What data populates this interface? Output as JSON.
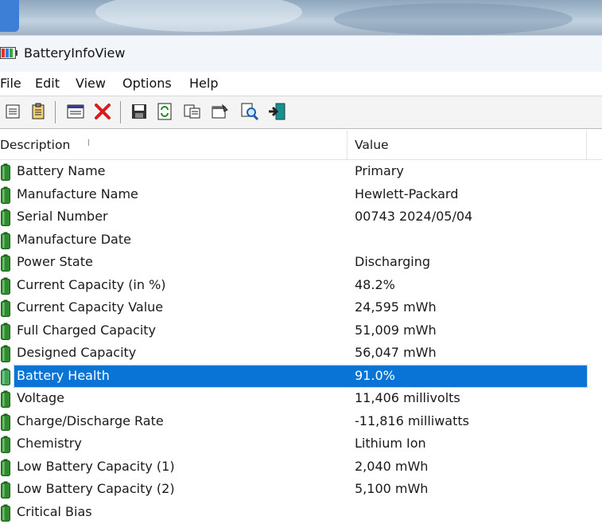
{
  "window": {
    "title": "BatteryInfoView"
  },
  "menu": [
    "File",
    "Edit",
    "View",
    "Options",
    "Help"
  ],
  "toolbar": {
    "buttons": [
      {
        "name": "properties-list-icon"
      },
      {
        "name": "clipboard-icon"
      },
      {
        "name": "html-report-icon"
      },
      {
        "name": "delete-x-icon"
      },
      {
        "name": "save-icon"
      },
      {
        "name": "refresh-icon"
      },
      {
        "name": "copy-icon"
      },
      {
        "name": "properties-icon"
      },
      {
        "name": "find-icon"
      },
      {
        "name": "exit-icon"
      }
    ]
  },
  "columns": {
    "description": "Description",
    "value": "Value"
  },
  "rows": [
    {
      "label": "Battery Name",
      "value": "Primary"
    },
    {
      "label": "Manufacture Name",
      "value": "Hewlett-Packard"
    },
    {
      "label": "Serial Number",
      "value": "00743 2024/05/04"
    },
    {
      "label": "Manufacture Date",
      "value": ""
    },
    {
      "label": "Power State",
      "value": "Discharging"
    },
    {
      "label": "Current Capacity (in %)",
      "value": "48.2%"
    },
    {
      "label": "Current Capacity Value",
      "value": "24,595 mWh"
    },
    {
      "label": "Full Charged Capacity",
      "value": "51,009 mWh"
    },
    {
      "label": "Designed Capacity",
      "value": "56,047 mWh"
    },
    {
      "label": "Battery Health",
      "value": "91.0%",
      "selected": true
    },
    {
      "label": "Voltage",
      "value": "11,406 millivolts"
    },
    {
      "label": "Charge/Discharge Rate",
      "value": "-11,816 milliwatts"
    },
    {
      "label": "Chemistry",
      "value": "Lithium Ion"
    },
    {
      "label": "Low Battery Capacity (1)",
      "value": "2,040 mWh"
    },
    {
      "label": "Low Battery Capacity (2)",
      "value": "5,100 mWh"
    },
    {
      "label": "Critical Bias",
      "value": ""
    }
  ],
  "colors": {
    "selection": "#0a74d6",
    "battery_green": "#2e8b2e"
  }
}
